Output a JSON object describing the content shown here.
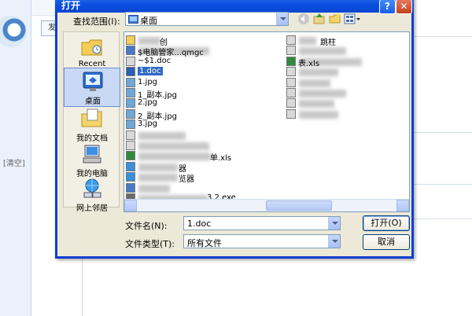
{
  "background": {
    "clear_link": "[清空]",
    "left_button_label": "发"
  },
  "dialog": {
    "title": "打开",
    "help_glyph": "?",
    "close_glyph": "✕",
    "lookin_label": "查找范围(I):",
    "lookin_value": "桌面",
    "places": [
      {
        "label": "Recent",
        "icon": "recent-folder-icon"
      },
      {
        "label": "桌面",
        "icon": "desktop-icon"
      },
      {
        "label": "我的文档",
        "icon": "my-documents-icon"
      },
      {
        "label": "我的电脑",
        "icon": "my-computer-icon"
      },
      {
        "label": "网上邻居",
        "icon": "network-icon"
      }
    ],
    "files_col1": [
      {
        "name": "创",
        "icon": "folder-icon"
      },
      {
        "name": "$电脑管家...qmgc",
        "icon": "app-icon"
      },
      {
        "name": "~$1.doc",
        "icon": "doc-icon"
      },
      {
        "name": "1.doc",
        "icon": "word-doc-icon",
        "selected": true
      },
      {
        "name": "1.jpg",
        "icon": "image-icon"
      },
      {
        "name": "1_副本.jpg",
        "icon": "image-icon"
      },
      {
        "name": "2.jpg",
        "icon": "image-icon"
      },
      {
        "name": "2_副本.jpg",
        "icon": "image-icon"
      },
      {
        "name": "3.jpg",
        "icon": "image-icon"
      },
      {
        "name": "",
        "icon": "doc-icon"
      },
      {
        "name": "",
        "icon": "doc-icon"
      },
      {
        "name": "单.xls",
        "icon": "xls-icon"
      },
      {
        "name": "器",
        "icon": "browser-icon"
      },
      {
        "name": "览器",
        "icon": "browser-icon"
      },
      {
        "name": "",
        "icon": "app-icon"
      },
      {
        "name": "3.2.exe",
        "icon": "exe-icon"
      }
    ],
    "files_col2": [
      {
        "name": "跳柱",
        "icon": "doc-icon"
      },
      {
        "name": "",
        "icon": "doc-icon"
      },
      {
        "name": "表.xls",
        "icon": "xls-icon"
      },
      {
        "name": "",
        "icon": "doc-icon"
      },
      {
        "name": "",
        "icon": "doc-icon"
      },
      {
        "name": "",
        "icon": "doc-icon"
      },
      {
        "name": "",
        "icon": "doc-icon"
      },
      {
        "name": "",
        "icon": "doc-icon"
      }
    ],
    "filename_label": "文件名(N):",
    "filename_value": "1.doc",
    "filetype_label": "文件类型(T):",
    "filetype_value": "所有文件",
    "open_button": "打开(O)",
    "cancel_button": "取消"
  },
  "colors": {
    "title_bar": "#0a4fe0",
    "dialog_face": "#ece9d8",
    "selection": "#316ac5"
  }
}
